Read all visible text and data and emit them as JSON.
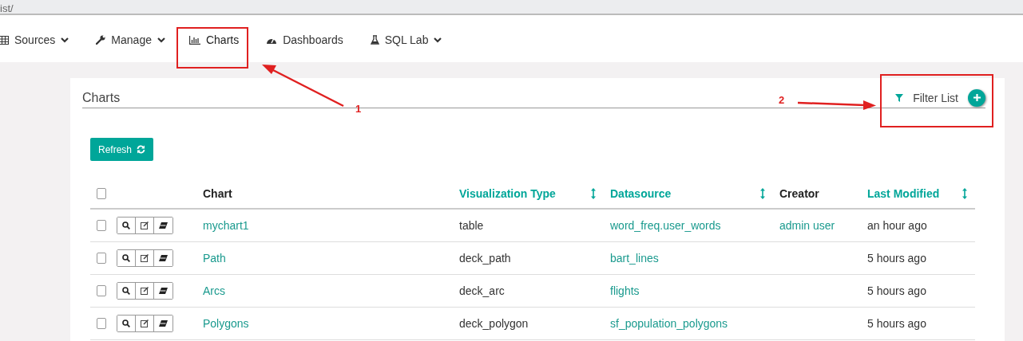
{
  "address_bar": {
    "text": "ist/"
  },
  "nav": [
    {
      "label": "Sources",
      "kind": "table",
      "has_menu": true,
      "selected": false
    },
    {
      "label": "Manage",
      "kind": "wrench",
      "has_menu": true,
      "selected": false
    },
    {
      "label": "Charts",
      "kind": "bar",
      "has_menu": false,
      "selected": true
    },
    {
      "label": "Dashboards",
      "kind": "gauge",
      "has_menu": false,
      "selected": false
    },
    {
      "label": "SQL Lab",
      "kind": "flask",
      "has_menu": true,
      "selected": false
    }
  ],
  "panel": {
    "title": "Charts",
    "filter_label": "Filter List"
  },
  "refresh_button": "Refresh",
  "table": {
    "select_all_checked": false,
    "columns": [
      {
        "label": "Chart",
        "sortable": false
      },
      {
        "label": "Visualization Type",
        "sortable": true
      },
      {
        "label": "Datasource",
        "sortable": true
      },
      {
        "label": "Creator",
        "sortable": false
      },
      {
        "label": "Last Modified",
        "sortable": true
      }
    ],
    "rows": [
      {
        "checked": false,
        "chart": "mychart1",
        "type": "table",
        "datasource": "word_freq.user_words",
        "creator": "admin user",
        "modified": "an hour ago"
      },
      {
        "checked": false,
        "chart": "Path",
        "type": "deck_path",
        "datasource": "bart_lines",
        "modified": "5 hours ago"
      },
      {
        "checked": false,
        "chart": "Arcs",
        "type": "deck_arc",
        "datasource": "flights",
        "modified": "5 hours ago"
      },
      {
        "checked": false,
        "chart": "Polygons",
        "type": "deck_polygon",
        "datasource": "sf_population_polygons",
        "modified": "5 hours ago"
      }
    ]
  },
  "annotations": [
    {
      "label": "1"
    },
    {
      "label": "2"
    }
  ]
}
